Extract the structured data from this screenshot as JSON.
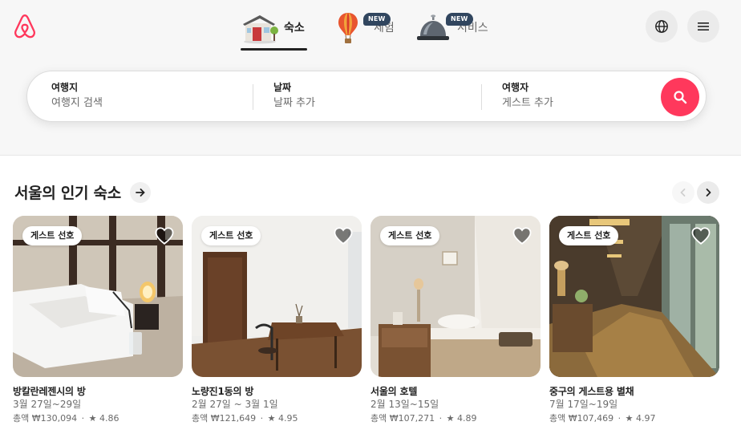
{
  "brand": {
    "name": "airbnb",
    "color": "#ff385c"
  },
  "nav": {
    "tabs": [
      {
        "label": "숙소",
        "icon": "house-icon",
        "active": true
      },
      {
        "label": "체험",
        "icon": "hot-air-balloon-icon",
        "badge": "NEW"
      },
      {
        "label": "서비스",
        "icon": "service-bell-icon",
        "badge": "NEW"
      }
    ],
    "language_icon": "globe-icon",
    "menu_icon": "hamburger-menu-icon"
  },
  "search": {
    "destination": {
      "title": "여행지",
      "placeholder": "여행지 검색"
    },
    "dates": {
      "title": "날짜",
      "placeholder": "날짜 추가"
    },
    "guests": {
      "title": "여행자",
      "placeholder": "게스트 추가"
    },
    "button_icon": "search-icon"
  },
  "section": {
    "title": "서울의 인기 숙소",
    "arrow_icon": "arrow-right-icon",
    "prev_icon": "chevron-left-icon",
    "next_icon": "chevron-right-icon"
  },
  "listings": [
    {
      "badge": "게스트 선호",
      "name": "방칼란레젠시의 방",
      "dates": "3월 27일~29일",
      "price": "총액 ₩130,094",
      "rating": "★ 4.86"
    },
    {
      "badge": "게스트 선호",
      "name": "노량진1동의 방",
      "dates": "2월 27일 ~ 3월 1일",
      "price": "총액 ₩121,649",
      "rating": "★ 4.95"
    },
    {
      "badge": "게스트 선호",
      "name": "서울의 호텔",
      "dates": "2월 13일~15일",
      "price": "총액 ₩107,271",
      "rating": "★ 4.89"
    },
    {
      "badge": "게스트 선호",
      "name": "중구의 게스트용 별채",
      "dates": "7월 17일~19일",
      "price": "총액 ₩107,469",
      "rating": "★ 4.97"
    }
  ]
}
